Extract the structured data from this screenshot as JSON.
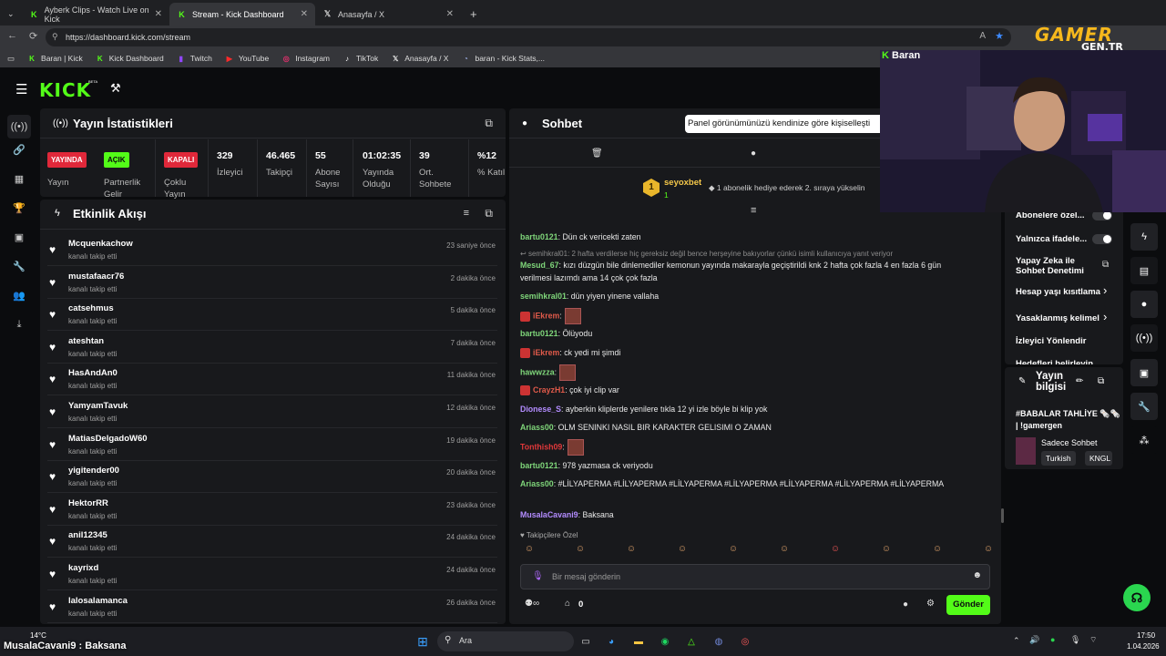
{
  "browser": {
    "tabs": [
      {
        "title": "Ayberk Clips - Watch Live on Kick"
      },
      {
        "title": "Stream - Kick Dashboard"
      },
      {
        "title": "Anasayfa / X"
      }
    ],
    "url": "https://dashboard.kick.com/stream",
    "bookmarks": [
      "Baran | Kick",
      "Kick Dashboard",
      "Twitch",
      "YouTube",
      "Instagram",
      "TikTok",
      "Anasayfa / X",
      "baran - Kick Stats,..."
    ]
  },
  "kick": {
    "logo": "KICK",
    "logo_badge": "BETA"
  },
  "stats": {
    "title": "Yayın İstatistikleri",
    "badges": [
      {
        "badge": "YAYINDA",
        "label": "Yayın"
      },
      {
        "badge": "AÇIK",
        "label": "Partnerlik Gelir"
      },
      {
        "badge": "KAPALI",
        "label": "Çoklu Yayın"
      }
    ],
    "items": [
      {
        "value": "329",
        "label": "İzleyici"
      },
      {
        "value": "46.465",
        "label": "Takipçi"
      },
      {
        "value": "55",
        "label": "Abone Sayısı"
      },
      {
        "value": "01:02:35",
        "label": "Yayında Olduğu"
      },
      {
        "value": "39",
        "label": "Ort. Sohbete"
      },
      {
        "value": "%12",
        "label": "% Katılım"
      }
    ]
  },
  "feed": {
    "title": "Etkinlik Akışı",
    "items": [
      {
        "name": "Mcquenkachow",
        "sub": "kanalı takip etti",
        "time": "23 saniye önce"
      },
      {
        "name": "mustafaacr76",
        "sub": "kanalı takip etti",
        "time": "2 dakika önce"
      },
      {
        "name": "catsehmus",
        "sub": "kanalı takip etti",
        "time": "5 dakika önce"
      },
      {
        "name": "ateshtan",
        "sub": "kanalı takip etti",
        "time": "7 dakika önce"
      },
      {
        "name": "HasAndAn0",
        "sub": "kanalı takip etti",
        "time": "11 dakika önce"
      },
      {
        "name": "YamyamTavuk",
        "sub": "kanalı takip etti",
        "time": "12 dakika önce"
      },
      {
        "name": "MatiasDelgadoW60",
        "sub": "kanalı takip etti",
        "time": "19 dakika önce"
      },
      {
        "name": "yigitender00",
        "sub": "kanalı takip etti",
        "time": "20 dakika önce"
      },
      {
        "name": "HektorRR",
        "sub": "kanalı takip etti",
        "time": "23 dakika önce"
      },
      {
        "name": "anil12345",
        "sub": "kanalı takip etti",
        "time": "24 dakika önce"
      },
      {
        "name": "kayrixd",
        "sub": "kanalı takip etti",
        "time": "24 dakika önce"
      },
      {
        "name": "lalosalamanca",
        "sub": "kanalı takip etti",
        "time": "26 dakika önce"
      }
    ]
  },
  "chat": {
    "title": "Sohbet",
    "tooltip": "Panel görünümünüzü kendinize göre kişiselleşti",
    "pinned_user": "seyoxbet",
    "pinned_count": "1",
    "pinned_rank": "1",
    "pinned_text": "1 abonelik hediye ederek 2. sıraya yükselin",
    "messages": [
      {
        "user": "bartu0121",
        "text": ": Dün ck vericekti zaten",
        "color": "#7fd67a"
      },
      {
        "reply": "semihkral01: 2 hafta verdilerse hiç gereksiz değil bence herşeyine bakıyorlar çünkü isimli kullanıcıya yanıt veriyor"
      },
      {
        "user": "Mesud_67",
        "text": ": kızı düzgün bile dinlemediler kemonun yayında makarayla geçiştirildi knk 2 hafta çok fazla 4 en fazla 6 gün verilmesi lazımdı ama 14 çok çok fazla",
        "color": "#7fd67a"
      },
      {
        "user": "semihkral01",
        "text": ": dün yiyen yinene vallaha",
        "color": "#7fd67a"
      },
      {
        "user": "iEkrem",
        "text": ":",
        "color": "#e05a4a",
        "emote": true
      },
      {
        "user": "bartu0121",
        "text": ": Ölüyodu",
        "color": "#7fd67a"
      },
      {
        "user": "iEkrem",
        "text": ": ck yedi mi şimdi",
        "color": "#e05a4a"
      },
      {
        "user": "hawwzza",
        "text": ":",
        "color": "#7fd67a",
        "emote": true
      },
      {
        "user": "CrayzH1",
        "text": ": çok iyi clip var",
        "color": "#e05a4a"
      },
      {
        "user": "Dionese_S",
        "text": ": ayberkin kliplerde yenilere tıkla 12 yi izle böyle bi klip yok",
        "color": "#b38cff"
      },
      {
        "user": "Ariass00",
        "text": ": OLM SENINKI NASIL BIR KARAKTER GELISIMI O ZAMAN",
        "color": "#7fd67a"
      },
      {
        "user": "Tonthish09",
        "text": ":",
        "color": "#e0383a",
        "emote": true
      },
      {
        "user": "bartu0121",
        "text": ": 978 yazmasa ck veriyodu",
        "color": "#7fd67a"
      },
      {
        "user": "Ariass00",
        "text": ": #LİLYAPERMA #LİLYAPERMA #LİLYAPERMA #LİLYAPERMA #LİLYAPERMA #LİLYAPERMA #LİLYAPERMA",
        "color": "#7fd67a"
      },
      {
        "user": "MusalaCavani9",
        "text": ": Baksana",
        "color": "#b38cff"
      }
    ],
    "followers_only": "Takipçilere Özel",
    "placeholder": "Bir mesaj gönderin",
    "send": "Gönder",
    "points": "0"
  },
  "settings": {
    "items": [
      "Abonelere özel...",
      "Yalnızca ifadele...",
      "Yapay Zeka ile Sohbet Denetimi",
      "Hesap yaşı kısıtlama",
      "Yasaklanmış kelimel",
      "İzleyici Yönlendir",
      "Hedefleri belirleyin"
    ]
  },
  "streaminfo": {
    "title": "Yayın bilgisi",
    "stream_title": "#BABALAR TAHLİYE 🗞️🗞️ | !gamergen",
    "category": "Sadece Sohbet",
    "tags": [
      "Turkish",
      "KNGL"
    ]
  },
  "overlay": {
    "streamer": "Baran",
    "watermark_top": "GAMER",
    "watermark_bottom": "GEN.TR",
    "caption": "MusalaCavani9 : Baksana"
  },
  "taskbar": {
    "search": "Ara",
    "weather": "14°C",
    "time": "17:50",
    "date": "1.04.2026"
  }
}
